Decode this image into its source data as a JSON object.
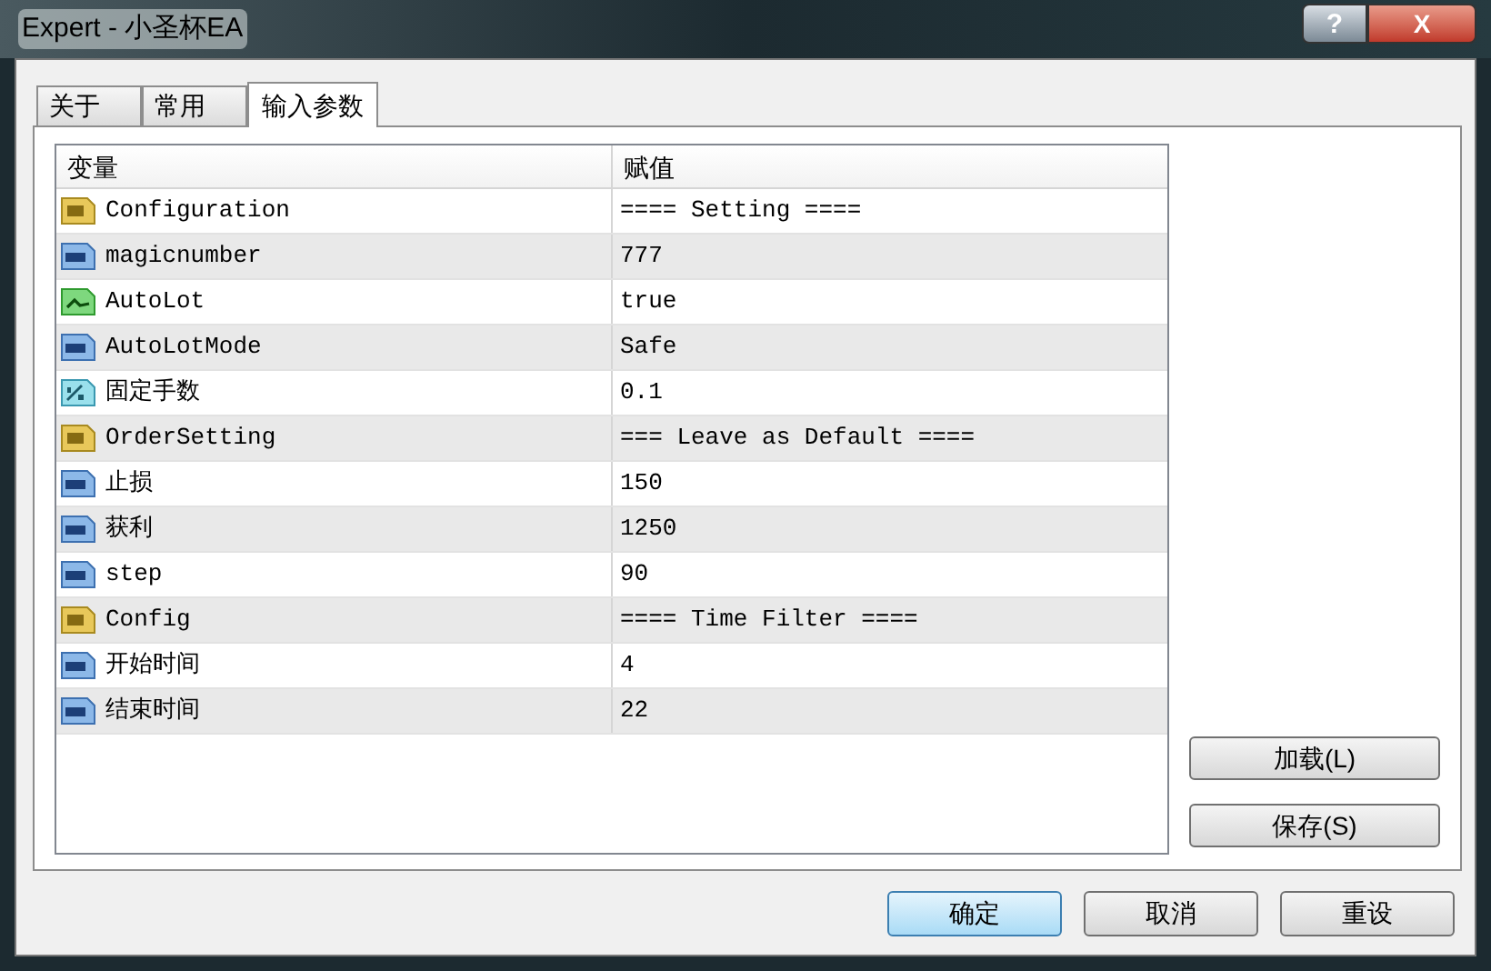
{
  "window": {
    "title": "Expert - 小圣杯EA",
    "help": "?",
    "close": "X"
  },
  "tabs": [
    {
      "label": "关于",
      "selected": false
    },
    {
      "label": "常用",
      "selected": false
    },
    {
      "label": "输入参数",
      "selected": true
    }
  ],
  "table": {
    "columns": [
      "变量",
      "赋值"
    ],
    "rows": [
      {
        "kind": "string",
        "name": "Configuration",
        "value": "==== Setting ===="
      },
      {
        "kind": "int",
        "name": "magicnumber",
        "value": "777"
      },
      {
        "kind": "bool",
        "name": "AutoLot",
        "value": "true"
      },
      {
        "kind": "int",
        "name": "AutoLotMode",
        "value": "Safe"
      },
      {
        "kind": "double",
        "name": "固定手数",
        "value": "0.1"
      },
      {
        "kind": "string",
        "name": "OrderSetting",
        "value": "=== Leave as Default ===="
      },
      {
        "kind": "int",
        "name": "止损",
        "value": "150"
      },
      {
        "kind": "int",
        "name": "获利",
        "value": "1250"
      },
      {
        "kind": "int",
        "name": "step",
        "value": "90"
      },
      {
        "kind": "string",
        "name": "Config",
        "value": "==== Time Filter ===="
      },
      {
        "kind": "int",
        "name": "开始时间",
        "value": "4"
      },
      {
        "kind": "int",
        "name": "结束时间",
        "value": "22"
      }
    ]
  },
  "side_buttons": [
    "加载(L)",
    "保存(S)"
  ],
  "buttons": [
    {
      "label": "确定",
      "selected": true
    },
    {
      "label": "取消",
      "selected": false
    },
    {
      "label": "重设",
      "selected": false
    }
  ]
}
